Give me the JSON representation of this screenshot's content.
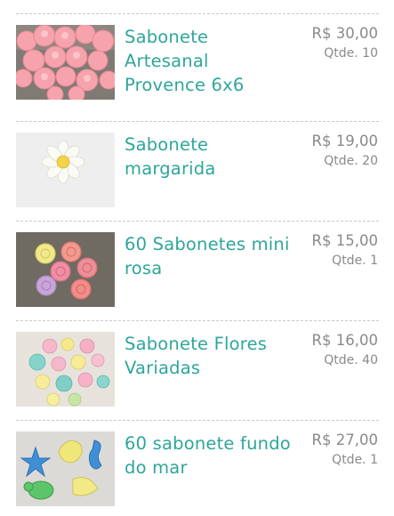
{
  "products": [
    {
      "name": "Sabonete Artesanal Provence 6x6",
      "price": "R$ 30,00",
      "quantity": "Qtde. 10",
      "image_icon": "pink-flower-soaps-image"
    },
    {
      "name": "Sabonete margarida",
      "price": "R$ 19,00",
      "quantity": "Qtde. 20",
      "image_icon": "daisy-soap-image"
    },
    {
      "name": "60 Sabonetes mini rosa",
      "price": "R$ 15,00",
      "quantity": "Qtde. 1",
      "image_icon": "mini-rose-soaps-image"
    },
    {
      "name": "Sabonete Flores Variadas",
      "price": "R$ 16,00",
      "quantity": "Qtde. 40",
      "image_icon": "assorted-flower-soaps-image"
    },
    {
      "name": "60 sabonete fundo do mar",
      "price": "R$ 27,00",
      "quantity": "Qtde. 1",
      "image_icon": "sea-creature-soaps-image"
    }
  ],
  "colors": {
    "title": "#2ea69a",
    "price": "#8a8a8a",
    "divider": "#c9c9c9"
  }
}
